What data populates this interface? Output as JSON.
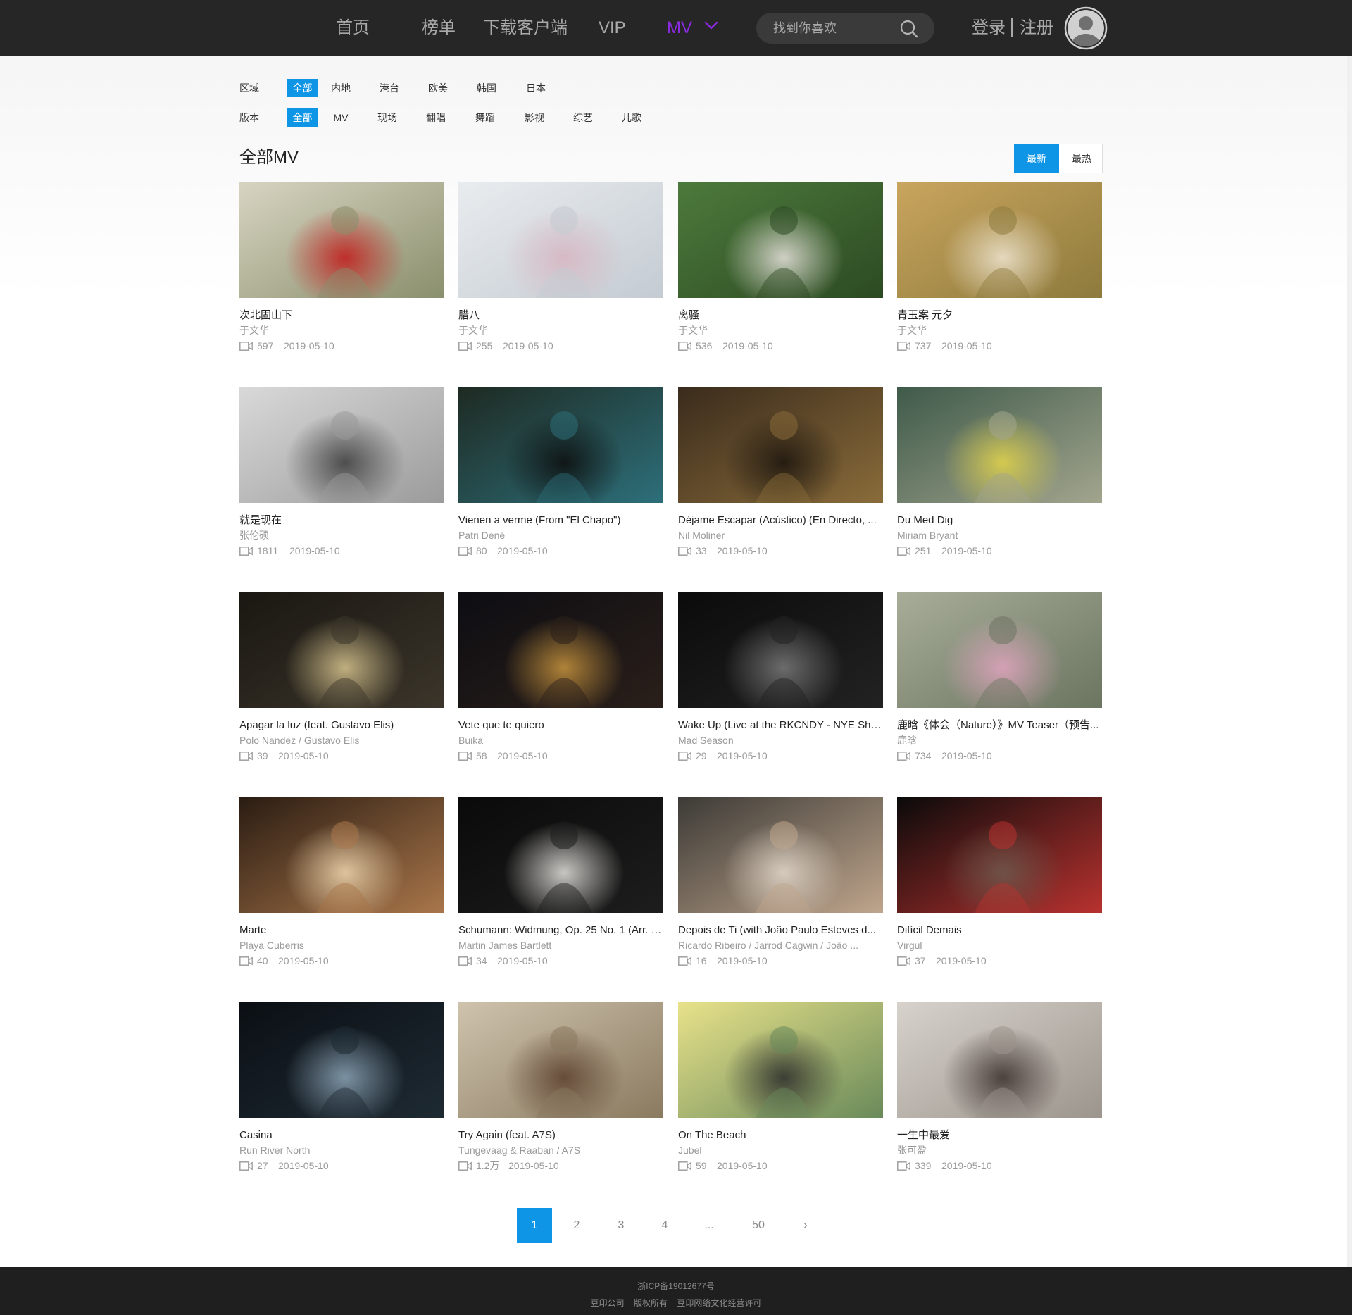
{
  "nav": {
    "items": [
      "首页",
      "榜单",
      "下载客户端",
      "VIP",
      "MV"
    ],
    "active": "MV",
    "search_placeholder": "找到你喜欢",
    "login": "登录",
    "register": "注册",
    "accent_color": "#8a2be2"
  },
  "filters": {
    "region": {
      "label": "区域",
      "options": [
        "全部",
        "内地",
        "港台",
        "欧美",
        "韩国",
        "日本"
      ],
      "selected": "全部"
    },
    "version": {
      "label": "版本",
      "options": [
        "全部",
        "MV",
        "现场",
        "翻唱",
        "舞蹈",
        "影视",
        "综艺",
        "儿歌"
      ],
      "selected": "全部"
    }
  },
  "section": {
    "title": "全部MV",
    "sort": {
      "latest": "最新",
      "hottest": "最热",
      "selected": "最新"
    }
  },
  "videos": [
    {
      "title": "次北固山下",
      "artist": "于文华",
      "plays": "597",
      "date": "2019-05-10",
      "palette": [
        "#d8d4c2",
        "#8a8f6c",
        "#c21818"
      ]
    },
    {
      "title": "腊八",
      "artist": "于文华",
      "plays": "255",
      "date": "2019-05-10",
      "palette": [
        "#e9ecef",
        "#c4cbd2",
        "#d7b4c0"
      ]
    },
    {
      "title": "离骚",
      "artist": "于文华",
      "plays": "536",
      "date": "2019-05-10",
      "palette": [
        "#4d7a3c",
        "#2c4a22",
        "#e9e4de"
      ]
    },
    {
      "title": "青玉案 元夕",
      "artist": "于文华",
      "plays": "737",
      "date": "2019-05-10",
      "palette": [
        "#c9a55e",
        "#8d7a3c",
        "#efe6d2"
      ]
    },
    {
      "title": "就是现在",
      "artist": "张伦硕",
      "plays": "1811",
      "date": "2019-05-10",
      "palette": [
        "#d9d9d9",
        "#9b9b9b",
        "#3c3c3c"
      ]
    },
    {
      "title": "Vienen a verme (From \"El Chapo\")",
      "artist": "Patri Dené",
      "plays": "80",
      "date": "2019-05-10",
      "palette": [
        "#1e2a22",
        "#2d6f7a",
        "#0c0c0c"
      ]
    },
    {
      "title": "Déjame Escapar (Acústico) (En Directo, ...",
      "artist": "Nil Moliner",
      "plays": "33",
      "date": "2019-05-10",
      "palette": [
        "#3a2b1c",
        "#8a6c3a",
        "#1a140d"
      ]
    },
    {
      "title": "Du Med Dig",
      "artist": "Miriam Bryant",
      "plays": "251",
      "date": "2019-05-10",
      "palette": [
        "#3f5a4a",
        "#a2a58e",
        "#e4d54a"
      ]
    },
    {
      "title": "Apagar la luz (feat. Gustavo Elis)",
      "artist": "Polo Nandez / Gustavo Elis",
      "plays": "39",
      "date": "2019-05-10",
      "palette": [
        "#1a1712",
        "#3b352a",
        "#d9c690"
      ]
    },
    {
      "title": "Vete que te quiero",
      "artist": "Buika",
      "plays": "58",
      "date": "2019-05-10",
      "palette": [
        "#0d0d12",
        "#2a1f1a",
        "#c9953e"
      ]
    },
    {
      "title": "Wake Up (Live at the RKCNDY - NYE Sho...",
      "artist": "Mad Season",
      "plays": "29",
      "date": "2019-05-10",
      "palette": [
        "#0b0b0b",
        "#222222",
        "#7a7a7a"
      ]
    },
    {
      "title": "鹿晗《体会（Nature）》MV Teaser（预告...",
      "artist": "鹿晗",
      "plays": "734",
      "date": "2019-05-10",
      "palette": [
        "#a7ad99",
        "#6b7560",
        "#e2a4c0"
      ]
    },
    {
      "title": "Marte",
      "artist": "Playa Cuberris",
      "plays": "40",
      "date": "2019-05-10",
      "palette": [
        "#2a1c12",
        "#a9764a",
        "#f0d8b0"
      ]
    },
    {
      "title": "Schumann: Widmung, Op. 25 No. 1 (Arr. L...",
      "artist": "Martin James Bartlett",
      "plays": "34",
      "date": "2019-05-10",
      "palette": [
        "#0a0a0a",
        "#1d1d1d",
        "#e8e6e1"
      ]
    },
    {
      "title": "Depois de Ti (with João Paulo Esteves d...",
      "artist": "Ricardo Ribeiro / Jarrod Cagwin / João ...",
      "plays": "16",
      "date": "2019-05-10",
      "palette": [
        "#3c3a36",
        "#bfa58c",
        "#e3d9cc"
      ]
    },
    {
      "title": "Difícil Demais",
      "artist": "Virgul",
      "plays": "37",
      "date": "2019-05-10",
      "palette": [
        "#0a0a0a",
        "#b8322f",
        "#6f5a4e"
      ]
    },
    {
      "title": "Casina",
      "artist": "Run River North",
      "plays": "27",
      "date": "2019-05-10",
      "palette": [
        "#0b0f14",
        "#1e2a33",
        "#8da6b8"
      ]
    },
    {
      "title": "Try Again (feat. A7S)",
      "artist": "Tungevaag & Raaban / A7S",
      "plays": "1.2万",
      "date": "2019-05-10",
      "palette": [
        "#cfc3ad",
        "#8a7a60",
        "#5a3f2c"
      ]
    },
    {
      "title": "On The Beach",
      "artist": "Jubel",
      "plays": "59",
      "date": "2019-05-10",
      "palette": [
        "#e8e28a",
        "#6a8a5a",
        "#2a2a2a"
      ]
    },
    {
      "title": "一生中最爱",
      "artist": "张可盈",
      "plays": "339",
      "date": "2019-05-10",
      "palette": [
        "#d7d2cc",
        "#9c958d",
        "#3a2f2a"
      ]
    }
  ],
  "pagination": {
    "pages": [
      "1",
      "2",
      "3",
      "4",
      "...",
      "50",
      "›"
    ],
    "current": "1"
  },
  "footer": {
    "icp": "浙ICP备19012677号",
    "links": [
      "豆印公司",
      "版权所有",
      "豆印网络文化经营许可"
    ]
  },
  "colors": {
    "topbar": "#262626",
    "accent_blue": "#0f95e6",
    "nav_active": "#8a2be2"
  }
}
